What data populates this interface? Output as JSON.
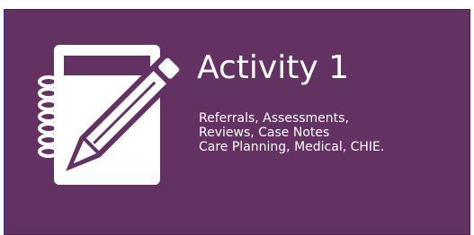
{
  "tile": {
    "title": "Activity 1",
    "description_lines": [
      "Referrals, Assessments,",
      "Reviews, Case Notes",
      "Care Planning, Medical, CHIE."
    ],
    "icon": "notebook-pencil-icon",
    "background_color": "#633262",
    "text_color": "#ffffff"
  }
}
